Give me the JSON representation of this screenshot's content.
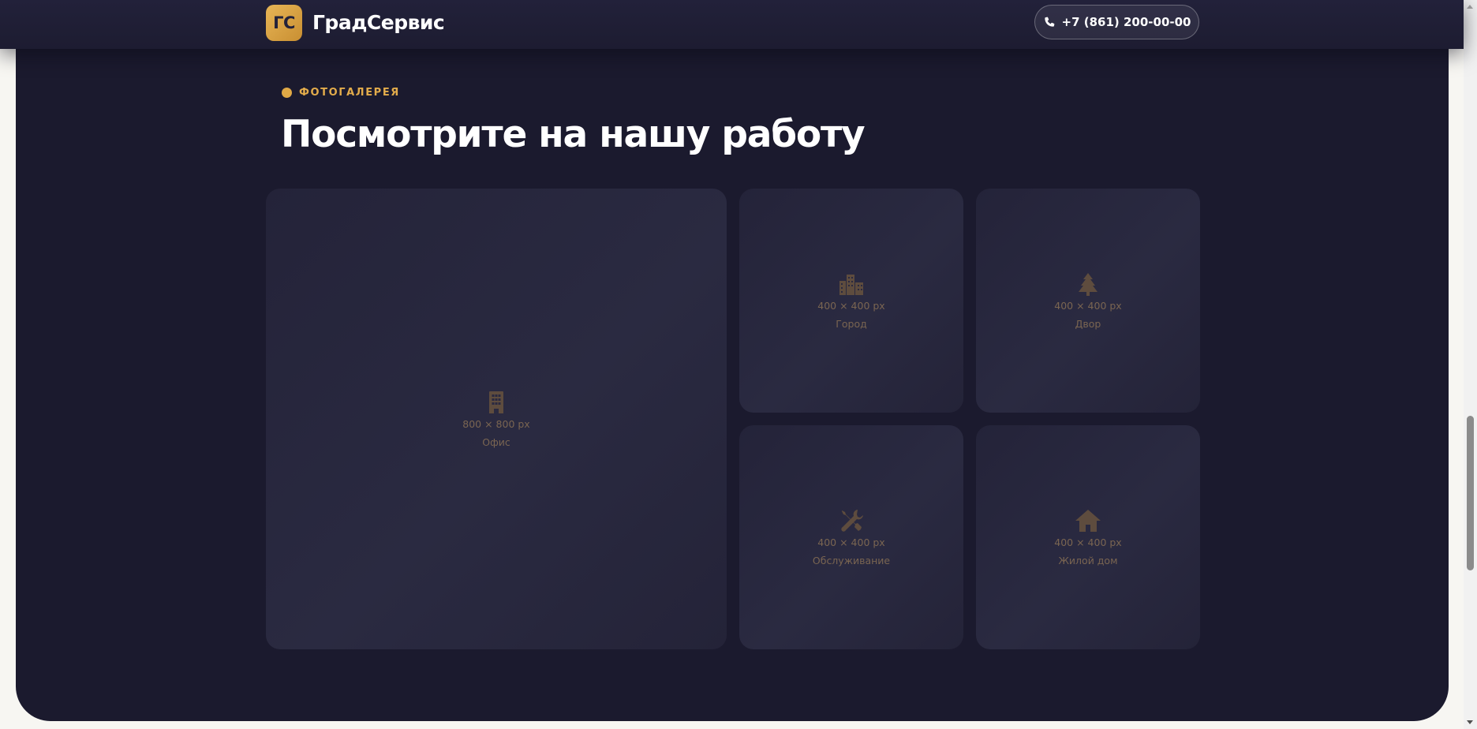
{
  "header": {
    "logo_badge": "ГС",
    "logo_name": "ГрадСервис",
    "phone": "+7 (861) 200-00-00"
  },
  "gallery": {
    "kicker": "ФОТОГАЛЕРЕЯ",
    "title": "Посмотрите на нашу работу",
    "tiles": [
      {
        "icon": "office-building-icon",
        "size": "800 × 800 px",
        "caption": "Офис"
      },
      {
        "icon": "city-icon",
        "size": "400 × 400 px",
        "caption": "Город"
      },
      {
        "icon": "tree-icon",
        "size": "400 × 400 px",
        "caption": "Двор"
      },
      {
        "icon": "tools-icon",
        "size": "400 × 400 px",
        "caption": "Обслуживание"
      },
      {
        "icon": "house-icon",
        "size": "400 × 400 px",
        "caption": "Жилой дом"
      }
    ]
  },
  "colors": {
    "accent": "#e3ac4b",
    "section_bg": "#1b1a2e",
    "page_bg": "#f7f6f2",
    "tile_text": "#7a6551"
  }
}
